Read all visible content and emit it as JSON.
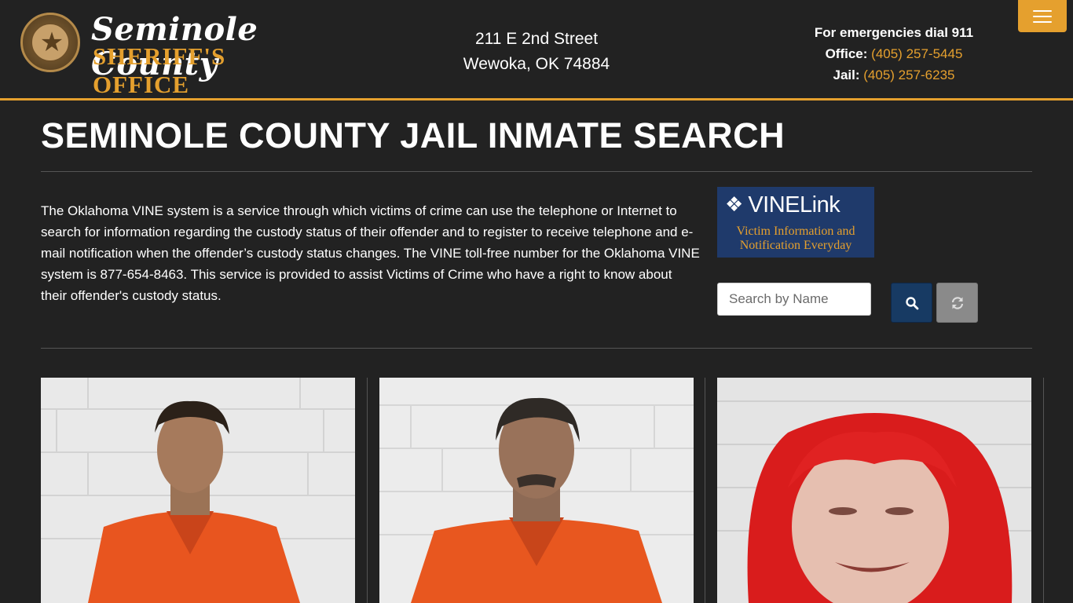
{
  "header": {
    "logo": {
      "title": "Seminole County",
      "subtitle": "SHERIFF'S OFFICE",
      "badge_top_text": "SHERIFF",
      "badge_bottom_text": "SEMINOLE COUNTY"
    },
    "address": {
      "line1": "211 E 2nd Street",
      "line2": "Wewoka, OK 74884"
    },
    "contact": {
      "emergency": "For emergencies dial 911",
      "office_label": "Office:",
      "office_phone": "(405) 257-5445",
      "jail_label": "Jail:",
      "jail_phone": "(405) 257-6235"
    },
    "menu_icon": "hamburger-menu-icon"
  },
  "main": {
    "title": "SEMINOLE COUNTY JAIL INMATE SEARCH",
    "intro": "The Oklahoma VINE system is a service through which victims of crime can use the telephone or Internet to search for information regarding the custody status of their offender and to register to receive telephone and e-mail notification when the offender’s custody status changes. The VINE toll-free number for the Oklahoma VINE system is 877-654-8463. This service is provided to assist Victims of Crime who have a right to know about their offender's custody status.",
    "vine": {
      "brand": "VINELink",
      "tagline_line1": "Victim Information and",
      "tagline_line2": "Notification Everyday"
    },
    "search": {
      "placeholder": "Search by Name",
      "value": "",
      "search_icon": "search-icon",
      "reset_icon": "refresh-icon"
    }
  },
  "colors": {
    "background": "#222222",
    "accent": "#e5a02e",
    "search_button": "#173a63",
    "reset_button": "#8a8a8a",
    "vine_background": "#1f3a6b"
  },
  "inmates": [
    {
      "photo": "mugshot-photo"
    },
    {
      "photo": "mugshot-photo"
    },
    {
      "photo": "mugshot-photo"
    }
  ]
}
